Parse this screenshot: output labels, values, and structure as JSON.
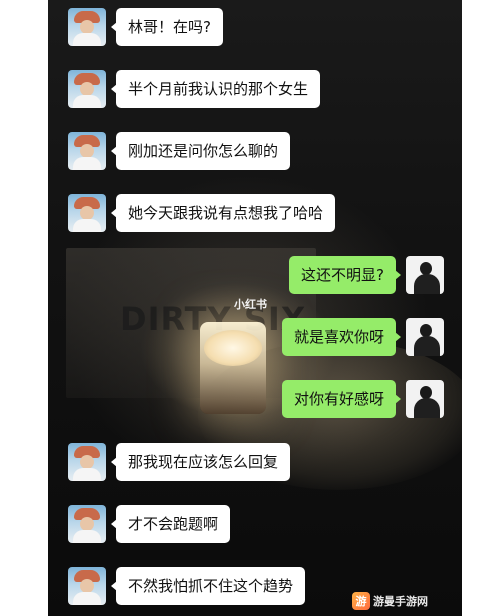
{
  "messages": [
    {
      "side": "left",
      "sender": "friend",
      "text": "林哥！在吗?"
    },
    {
      "side": "left",
      "sender": "friend",
      "text": "半个月前我认识的那个女生"
    },
    {
      "side": "left",
      "sender": "friend",
      "text": "刚加还是问你怎么聊的"
    },
    {
      "side": "left",
      "sender": "friend",
      "text": "她今天跟我说有点想我了哈哈"
    },
    {
      "side": "right",
      "sender": "me",
      "text": "这还不明显?"
    },
    {
      "side": "right",
      "sender": "me",
      "text": "就是喜欢你呀"
    },
    {
      "side": "right",
      "sender": "me",
      "text": "对你有好感呀"
    },
    {
      "side": "left",
      "sender": "friend",
      "text": "那我现在应该怎么回复"
    },
    {
      "side": "left",
      "sender": "friend",
      "text": "才不会跑题啊"
    },
    {
      "side": "left",
      "sender": "friend",
      "text": "不然我怕抓不住这个趋势"
    }
  ],
  "background": {
    "box_text": "DIRTY SIX",
    "watermark_center": "小红书"
  },
  "watermark": {
    "icon_glyph": "游",
    "text": "游曼手游网"
  },
  "colors": {
    "sent_bubble": "#95ec69",
    "received_bubble": "#ffffff",
    "chat_background": "#0f0f0f"
  }
}
